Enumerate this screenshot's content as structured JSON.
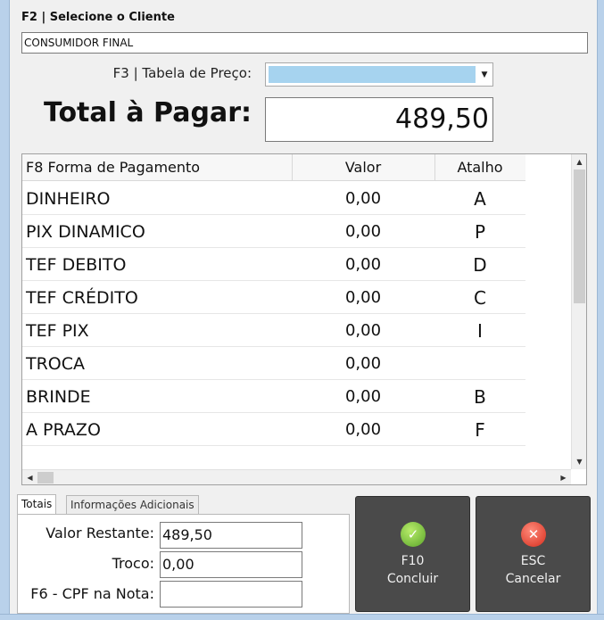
{
  "client": {
    "label": "F2 | Selecione o Cliente",
    "value": "CONSUMIDOR FINAL"
  },
  "price_table": {
    "label": "F3 | Tabela de Preço:",
    "value": ""
  },
  "total": {
    "label": "Total à Pagar:",
    "value": "489,50"
  },
  "payments": {
    "headers": [
      "F8 Forma de Pagamento",
      "Valor",
      "Atalho"
    ],
    "rows": [
      {
        "name": "DINHEIRO",
        "value": "0,00",
        "shortcut": "A"
      },
      {
        "name": "PIX DINAMICO",
        "value": "0,00",
        "shortcut": "P"
      },
      {
        "name": "TEF DEBITO",
        "value": "0,00",
        "shortcut": "D"
      },
      {
        "name": "TEF CRÉDITO",
        "value": "0,00",
        "shortcut": "C"
      },
      {
        "name": "TEF PIX",
        "value": "0,00",
        "shortcut": "I"
      },
      {
        "name": "TROCA",
        "value": "0,00",
        "shortcut": ""
      },
      {
        "name": "BRINDE",
        "value": "0,00",
        "shortcut": "B"
      },
      {
        "name": "A PRAZO",
        "value": "0,00",
        "shortcut": "F"
      }
    ]
  },
  "tabs": [
    "Totais",
    "Informações Adicionais"
  ],
  "totals": {
    "remaining_label": "Valor Restante:",
    "remaining_value": "489,50",
    "change_label": "Troco:",
    "change_value": "0,00",
    "cpf_label": "F6 - CPF na Nota:",
    "cpf_value": ""
  },
  "buttons": {
    "confirm": {
      "key": "F10",
      "label": "Concluir",
      "icon": "check-icon"
    },
    "cancel": {
      "key": "ESC",
      "label": "Cancelar",
      "icon": "close-icon"
    }
  },
  "colors": {
    "select_fill": "#a6d3ef",
    "button_bg": "#4a4a4a",
    "confirm_icon": "#5aa52a",
    "cancel_icon": "#d52d1d",
    "window_frame": "#b9d1ea"
  }
}
